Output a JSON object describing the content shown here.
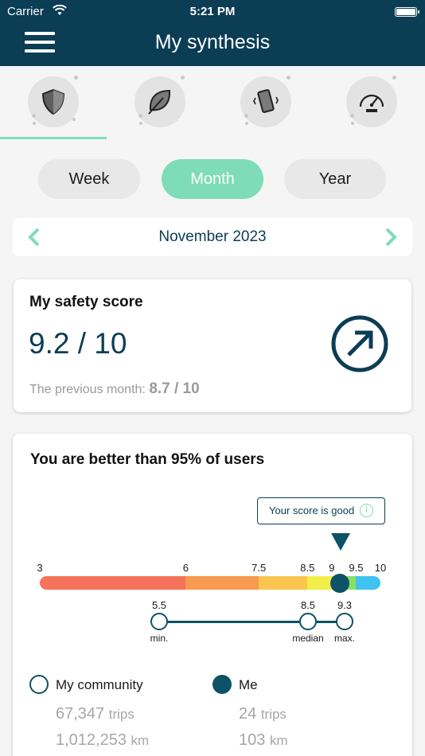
{
  "status_bar": {
    "carrier": "Carrier",
    "time": "5:21 PM"
  },
  "header": {
    "title": "My synthesis"
  },
  "tabs": [
    {
      "icon": "shield-icon",
      "active": true
    },
    {
      "icon": "leaf-icon",
      "active": false
    },
    {
      "icon": "phone-vibrate-icon",
      "active": false
    },
    {
      "icon": "speedometer-icon",
      "active": false
    }
  ],
  "periods": {
    "week": "Week",
    "month": "Month",
    "year": "Year",
    "selected": "month"
  },
  "month_nav": {
    "label": "November 2023"
  },
  "safety": {
    "title": "My safety score",
    "score": "9.2 / 10",
    "previous_label": "The previous month:",
    "previous_value": "8.7 / 10"
  },
  "comparison": {
    "title": "You are better than 95% of users",
    "tooltip": "Your score is good",
    "info": "i",
    "scale_labels": [
      "3",
      "6",
      "7.5",
      "8.5",
      "9",
      "9.5",
      "10"
    ],
    "scale_values": [
      3,
      6,
      7.5,
      8.5,
      9,
      9.5,
      10
    ],
    "segment_colors": [
      "#f5735a",
      "#f89a4f",
      "#fbc64f",
      "#f2ef4a",
      "#89e066",
      "#3fc3f0"
    ],
    "my_score": 9.2,
    "markers": [
      {
        "value": "5.5",
        "name": "min."
      },
      {
        "value": "8.5",
        "name": "median"
      },
      {
        "value": "9.3",
        "name": "max."
      }
    ]
  },
  "legend": {
    "community": {
      "label": "My community",
      "trips": "67,347",
      "trips_unit": "trips",
      "km": "1,012,253",
      "km_unit": "km"
    },
    "me": {
      "label": "Me",
      "trips": "24",
      "trips_unit": "trips",
      "km": "103",
      "km_unit": "km"
    }
  },
  "colors": {
    "primary": "#0b3d55",
    "accent": "#7fdcb8"
  }
}
